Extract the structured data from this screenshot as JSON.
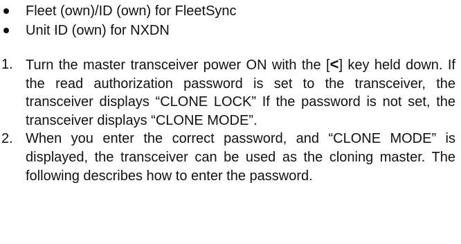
{
  "bullets": [
    "Fleet (own)/ID (own) for FleetSync",
    "Unit ID (own) for NXDN"
  ],
  "steps": [
    {
      "number": "1.",
      "before_key": "Turn the master transceiver power ON with the [",
      "key": "<",
      "after_key": "] key held down.  If the read authorization password is set to the transceiver, the transceiver displays “CLONE LOCK”  If the password is not set, the transceiver displays “CLONE MODE”."
    },
    {
      "number": "2.",
      "text": "When you enter the correct password, and “CLONE MODE” is displayed, the transceiver can be used as the cloning master.  The following describes how to enter the password."
    }
  ]
}
